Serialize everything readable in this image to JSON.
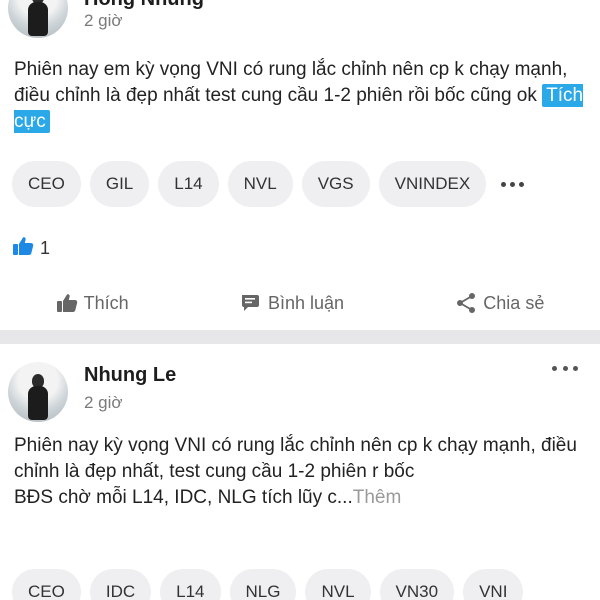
{
  "posts": [
    {
      "author": "Hồng Nhung",
      "time": "2 giờ",
      "text": "Phiên nay em kỳ vọng VNI có rung lắc chỉnh nên cp k chạy mạnh, điều chỉnh là đẹp nhất test cung cầu 1-2 phiên rồi bốc cũng ok",
      "sentiment": "Tích cực",
      "tags": [
        "CEO",
        "GIL",
        "L14",
        "NVL",
        "VGS",
        "VNINDEX"
      ],
      "reaction_count": "1",
      "actions": {
        "like": "Thích",
        "comment": "Bình luận",
        "share": "Chia sẻ"
      }
    },
    {
      "author": "Nhung Le",
      "time": "2 giờ",
      "text_line_1": "Phiên nay kỳ vọng VNI có rung lắc chỉnh nên cp k chạy mạnh, điều chỉnh là đẹp nhất, test cung cầu 1-2 phiên r bốc",
      "text_line_2": "BĐS chờ mỗi L14, IDC, NLG tích lũy c...",
      "more_label": "Thêm",
      "tags": [
        "CEO",
        "IDC",
        "L14",
        "NLG",
        "NVL",
        "VN30",
        "VNI"
      ]
    }
  ],
  "colors": {
    "accent": "#2aa8e8",
    "like_blue": "#1e88e5",
    "divider": "#e7e7e9",
    "tag_bg": "#efeff1"
  },
  "icons": [
    "thumbs-up-icon",
    "comment-icon",
    "share-icon",
    "more-dots-icon"
  ]
}
